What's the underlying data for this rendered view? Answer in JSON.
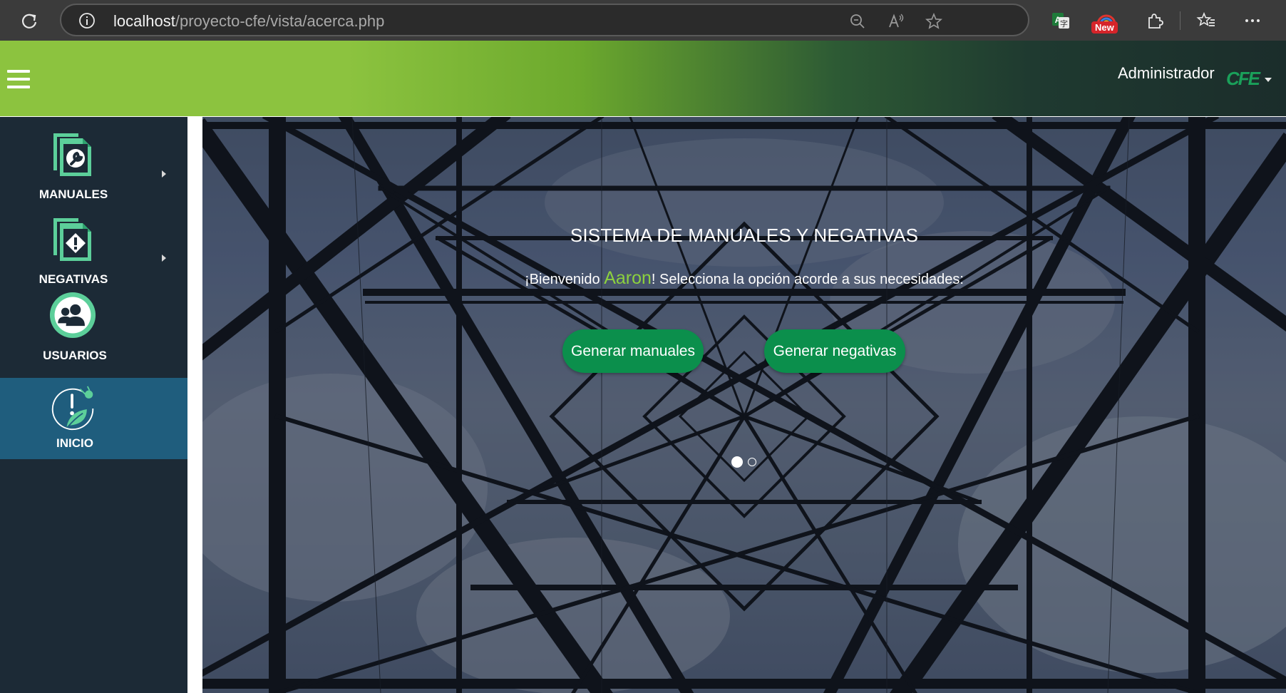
{
  "browser": {
    "url_host": "localhost",
    "url_path": "/proyecto-cfe/vista/acerca.php",
    "new_badge": "New"
  },
  "header": {
    "user_name": "Administrador",
    "logo_text": "CFE"
  },
  "sidebar": {
    "items": [
      {
        "label": "MANUALES",
        "icon": "manual-wrench-icon",
        "has_submenu": true,
        "active": false
      },
      {
        "label": "NEGATIVAS",
        "icon": "negative-warning-icon",
        "has_submenu": true,
        "active": false
      },
      {
        "label": "USUARIOS",
        "icon": "users-icon",
        "has_submenu": false,
        "active": false
      },
      {
        "label": "INICIO",
        "icon": "home-leaf-icon",
        "has_submenu": false,
        "active": true
      }
    ]
  },
  "hero": {
    "title": "SISTEMA DE MANUALES Y NEGATIVAS",
    "welcome_prefix": "¡Bienvenido ",
    "welcome_user": "Aaron",
    "welcome_suffix": "! Selecciona la opción acorde a sus necesidades:",
    "buttons": {
      "manuales": "Generar manuales",
      "negativas": "Generar negativas"
    },
    "carousel": {
      "slides": 2,
      "active_index": 0
    }
  },
  "colors": {
    "brand_green": "#8cc33f",
    "button_green": "#0b8f4c",
    "sidebar_bg": "#1c2a36",
    "sidebar_active": "#1f5d7d",
    "icon_mint": "#5ccf9a"
  }
}
